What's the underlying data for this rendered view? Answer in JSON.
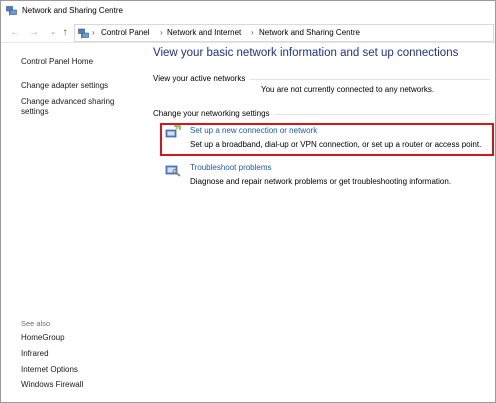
{
  "window": {
    "title": "Network and Sharing Centre",
    "title_icon": "network-icon"
  },
  "address": {
    "back_icon": "arrow-left-icon",
    "forward_icon": "arrow-right-icon",
    "recent_icon": "chevron-down-icon",
    "up_icon": "arrow-up-icon",
    "location_icon": "network-icon",
    "crumbs": [
      "Control Panel",
      "Network and Internet",
      "Network and Sharing Centre"
    ],
    "separator": "›"
  },
  "sidebar": {
    "home": "Control Panel Home",
    "links": [
      "Change adapter settings",
      "Change advanced sharing",
      "settings"
    ],
    "see_also_label": "See also",
    "see_also": [
      "HomeGroup",
      "Infrared",
      "Internet Options",
      "Windows Firewall"
    ]
  },
  "main": {
    "title": "View your basic network information and set up connections",
    "active_networks_label": "View your active networks",
    "not_connected": "You are not currently connected to any networks.",
    "change_settings_label": "Change your networking settings",
    "tasks": [
      {
        "title": "Set up a new connection or network",
        "description": "Set up a broadband, dial-up or VPN connection, or set up a router or access point.",
        "icon": "new-connection-icon"
      },
      {
        "title": "Troubleshoot problems",
        "description": "Diagnose and repair network problems or get troubleshooting information.",
        "icon": "troubleshoot-icon"
      }
    ]
  },
  "colors": {
    "title_blue": "#1e3287",
    "link_blue": "#1e5aa8",
    "highlight_red": "#d9151c"
  }
}
